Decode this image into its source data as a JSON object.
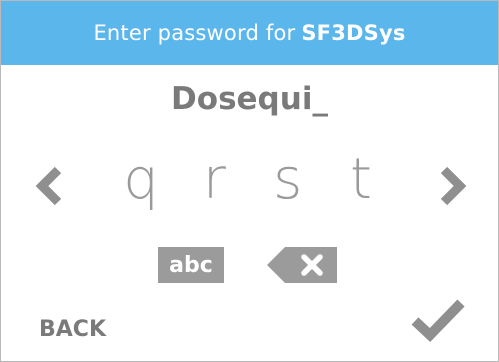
{
  "header": {
    "prompt": "Enter password for",
    "system_name": "SF3DSys",
    "background_color": "#5bb6ec"
  },
  "password_entry": {
    "entered_text": "Dosequi_"
  },
  "character_picker": {
    "prev_icon": "chevron-left-icon",
    "next_icon": "chevron-right-icon",
    "letters": [
      "q",
      "r",
      "s",
      "t"
    ]
  },
  "controls": {
    "case_toggle_label": "abc",
    "delete_icon": "backspace-icon",
    "back_label": "BACK",
    "confirm_icon": "checkmark-icon",
    "control_color": "#9b9b9b"
  }
}
